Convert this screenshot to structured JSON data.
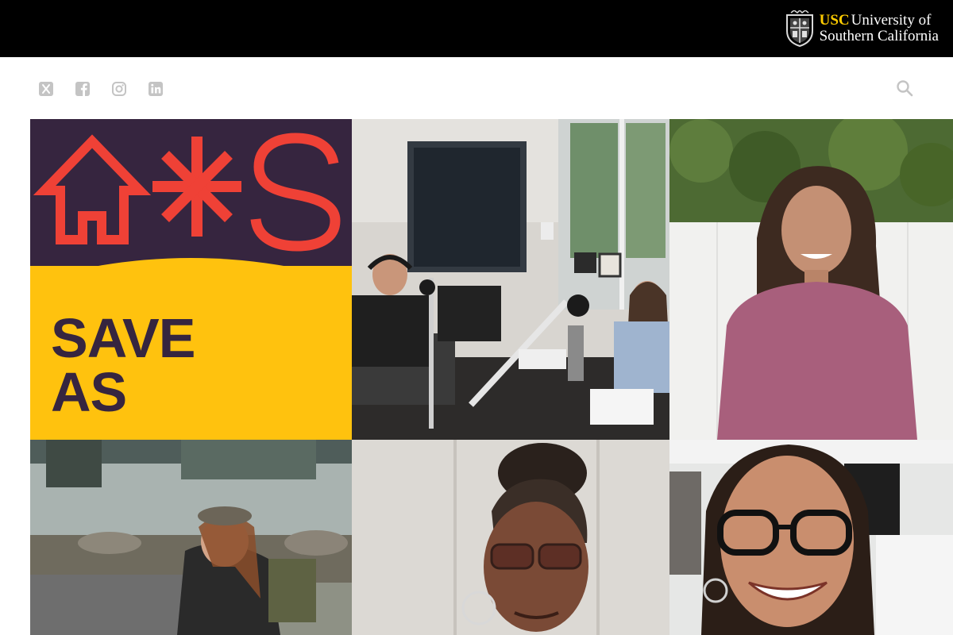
{
  "header": {
    "brand": {
      "usc": "USC",
      "line1_rest": "University of",
      "line2": "Southern California",
      "seal_icon": "usc-seal-icon",
      "accent_color": "#FFCC00"
    }
  },
  "social": {
    "items": [
      {
        "icon": "x-twitter-icon"
      },
      {
        "icon": "facebook-icon"
      },
      {
        "icon": "instagram-icon"
      },
      {
        "icon": "linkedin-icon"
      }
    ],
    "search_icon": "search-icon"
  },
  "tiles": {
    "logo": {
      "word1": "SAVE",
      "word2": "AS",
      "background": "#36253F",
      "accent_yellow": "#FFC20E",
      "accent_red": "#EF4136"
    }
  }
}
